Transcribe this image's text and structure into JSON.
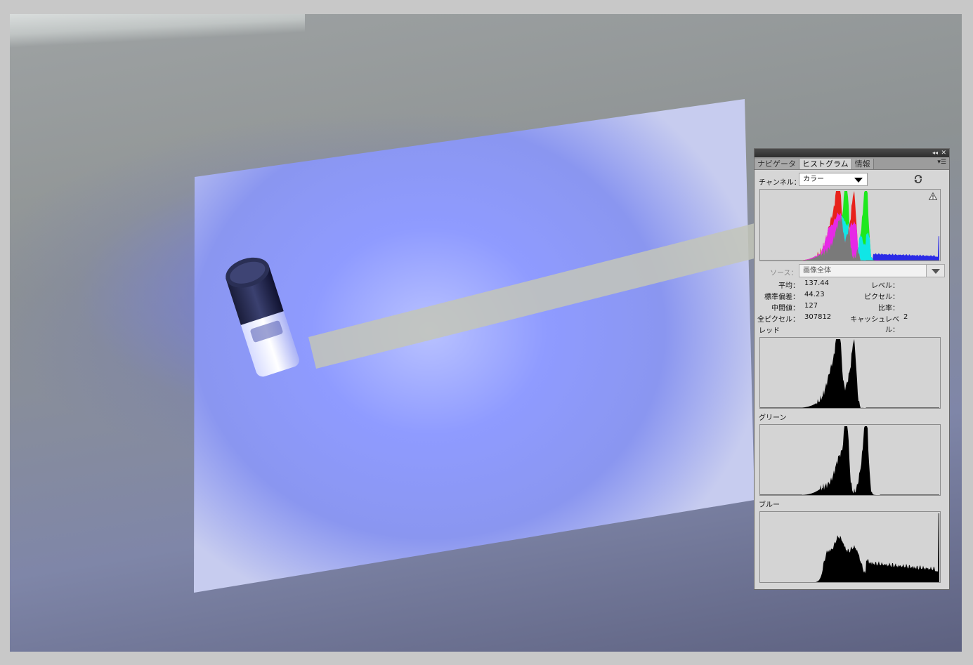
{
  "panel": {
    "tabs": [
      {
        "label": "ナビゲータ",
        "active": false
      },
      {
        "label": "ヒストグラム",
        "active": true
      },
      {
        "label": "情報",
        "active": false
      }
    ],
    "channel_label": "チャンネル：",
    "channel_value": "カラー",
    "source_label": "ソース：",
    "source_value": "画像全体",
    "stats": {
      "mean_label": "平均：",
      "mean_value": "137.44",
      "stddev_label": "標準偏差：",
      "stddev_value": "44.23",
      "median_label": "中間値：",
      "median_value": "127",
      "pixels_label": "全ピクセル：",
      "pixels_value": "307812",
      "level_label": "レベル：",
      "count_label": "ピクセル：",
      "percentile_label": "比率：",
      "cache_label": "キャッシュレベル：",
      "cache_value": "2"
    },
    "channels": {
      "red": "レッド",
      "green": "グリーン",
      "blue": "ブルー"
    },
    "colors": {
      "red": "#e8221b",
      "green": "#1ee81e",
      "blue": "#2a2ae6",
      "cyan": "#10e6e6",
      "magenta": "#e629e6",
      "yellow": "#e6e61e",
      "gray": "#7a7a7a"
    }
  }
}
